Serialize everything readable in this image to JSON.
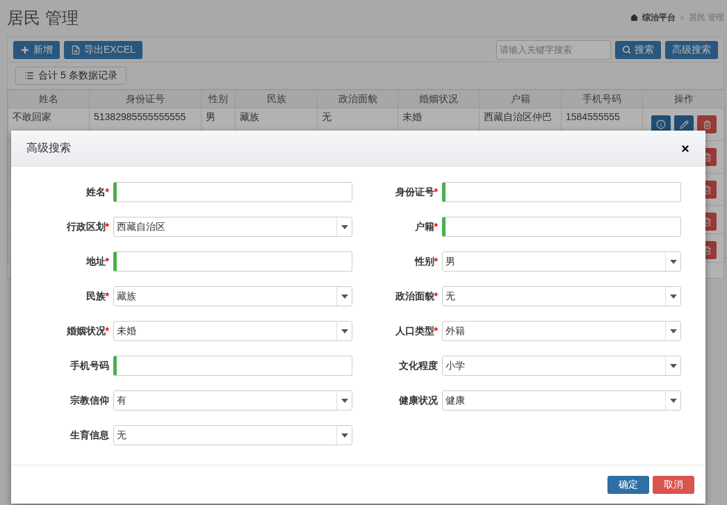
{
  "page_title": "居民 管理",
  "breadcrumb_separator": ">",
  "breadcrumb": [
    {
      "label": "综治平台",
      "current": false
    },
    {
      "label": "居民 管理",
      "current": true
    }
  ],
  "toolbar": {
    "buttons": [
      {
        "kind": "add",
        "label": "新增"
      },
      {
        "kind": "export",
        "label": "导出EXCEL"
      }
    ],
    "search": {
      "placeholder": "请输入关键字搜索"
    },
    "search_button": "搜索",
    "advanced_button": "高级搜索"
  },
  "record_count": "合计 5 条数据记录",
  "table": {
    "columns": [
      "姓名",
      "身份证号",
      "性别",
      "民族",
      "政治面貌",
      "婚姻状况",
      "户籍",
      "手机号码",
      "操作"
    ],
    "rows": [
      {
        "cells": [
          "不敢回家",
          "51382985555555555",
          "男",
          "藏族",
          "无",
          "未婚",
          "西藏自治区仲巴",
          "1584555555"
        ]
      },
      {
        "cells": []
      },
      {
        "cells": []
      },
      {
        "cells": []
      },
      {
        "cells": []
      }
    ]
  },
  "modal": {
    "title": "高级搜索",
    "required_mark": "*",
    "fields": [
      {
        "label": "姓名",
        "required": true,
        "kind": "text"
      },
      {
        "label": "身份证号",
        "required": true,
        "kind": "text"
      },
      {
        "label": "行政区划",
        "required": true,
        "kind": "select",
        "value": "西藏自治区"
      },
      {
        "label": "户籍",
        "required": true,
        "kind": "text"
      },
      {
        "label": "地址",
        "required": true,
        "kind": "text"
      },
      {
        "label": "性别",
        "required": true,
        "kind": "select",
        "value": "男"
      },
      {
        "label": "民族",
        "required": true,
        "kind": "select",
        "value": "藏族"
      },
      {
        "label": "政治面貌",
        "required": true,
        "kind": "select",
        "value": "无"
      },
      {
        "label": "婚姻状况",
        "required": true,
        "kind": "select",
        "value": "未婚"
      },
      {
        "label": "人口类型",
        "required": true,
        "kind": "select",
        "value": "外籍"
      },
      {
        "label": "手机号码",
        "required": false,
        "kind": "text"
      },
      {
        "label": "文化程度",
        "required": false,
        "kind": "select",
        "value": "小学"
      },
      {
        "label": "宗教信仰",
        "required": false,
        "kind": "select",
        "value": "有"
      },
      {
        "label": "健康状况",
        "required": false,
        "kind": "select",
        "value": "健康"
      },
      {
        "label": "生育信息",
        "required": false,
        "kind": "select",
        "value": "无"
      }
    ],
    "buttons": [
      {
        "kind": "primary",
        "label": "确定"
      },
      {
        "kind": "danger",
        "label": "取消"
      }
    ]
  }
}
